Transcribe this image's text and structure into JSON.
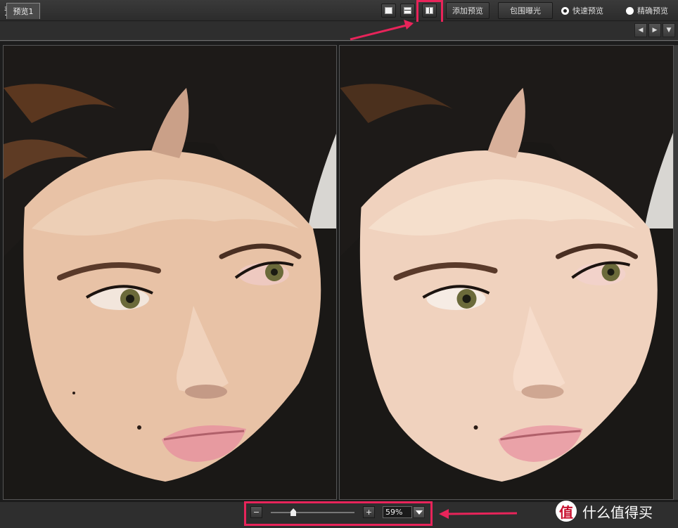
{
  "window": {
    "title": "预览"
  },
  "view_modes": [
    {
      "icon": "single-view-icon"
    },
    {
      "icon": "split-horizontal-icon"
    },
    {
      "icon": "split-vertical-icon",
      "selected": true
    }
  ],
  "toolbar": {
    "add_preview": "添加预览",
    "bracket_exposure": "包围曝光",
    "quick_preview": "快速预览",
    "accurate_preview": "精确预览",
    "selected_mode": "快速预览"
  },
  "tabs": [
    {
      "label": "预览1"
    }
  ],
  "tab_nav": {
    "prev_icon": "triangle-left-icon",
    "next_icon": "triangle-right-icon",
    "menu_icon": "triangle-down-icon"
  },
  "zoom": {
    "minus": "−",
    "plus": "+",
    "value": "59%",
    "slider_fraction": 0.27
  },
  "watermark": {
    "icon_char": "值",
    "text": "什么值得买"
  },
  "colors": {
    "highlight": "#e8245a",
    "background": "#2b2b2b"
  }
}
